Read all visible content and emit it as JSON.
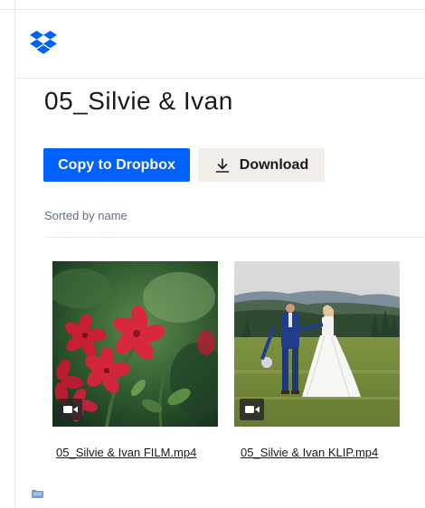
{
  "header": {
    "logo_icon": "dropbox-logo-icon",
    "brand_color": "#0061fe"
  },
  "folder": {
    "title": "05_Silvie & Ivan"
  },
  "actions": {
    "copy_label": "Copy to Dropbox",
    "download_label": "Download",
    "download_icon": "download-icon"
  },
  "listing": {
    "sort_label": "Sorted by name",
    "files": [
      {
        "name": "05_Silvie & Ivan FILM.mp4",
        "thumbnail": "red-flowers-thumbnail",
        "type_icon": "video-camera-icon"
      },
      {
        "name": "05_Silvie & Ivan KLIP.mp4",
        "thumbnail": "wedding-couple-thumbnail",
        "type_icon": "video-camera-icon"
      }
    ]
  },
  "footer": {
    "icon": "folder-icon"
  }
}
